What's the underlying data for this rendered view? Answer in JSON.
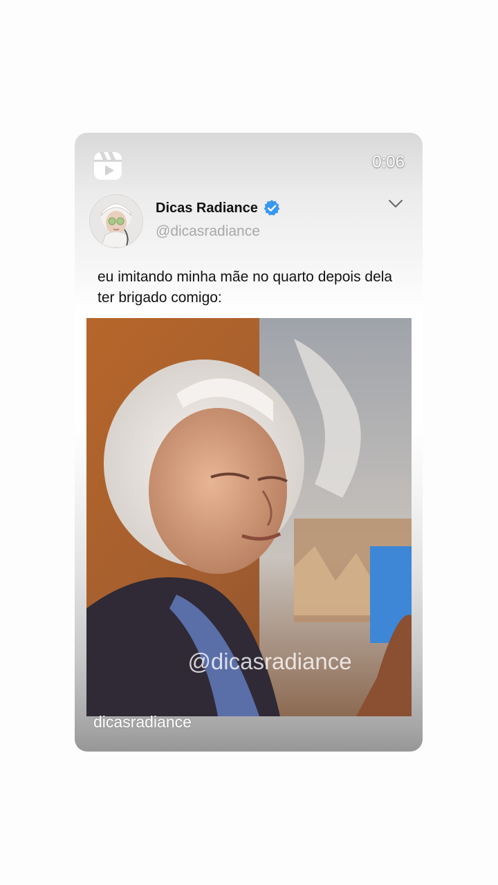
{
  "post": {
    "duration": "0:06",
    "author_name": "Dicas Radiance",
    "author_handle": "@dicasradiance",
    "caption": "eu imitando minha mãe no quarto depois dela ter brigado comigo:",
    "media_watermark": "@dicasradiance",
    "footer_username": "dicasradiance"
  },
  "icons": {
    "reels": "reels-icon",
    "verified": "verified-badge-icon",
    "menu": "chevron-down-icon"
  },
  "colors": {
    "verified_badge": "#3897f0",
    "author_name": "#111111",
    "handle": "#a9a9a9"
  }
}
